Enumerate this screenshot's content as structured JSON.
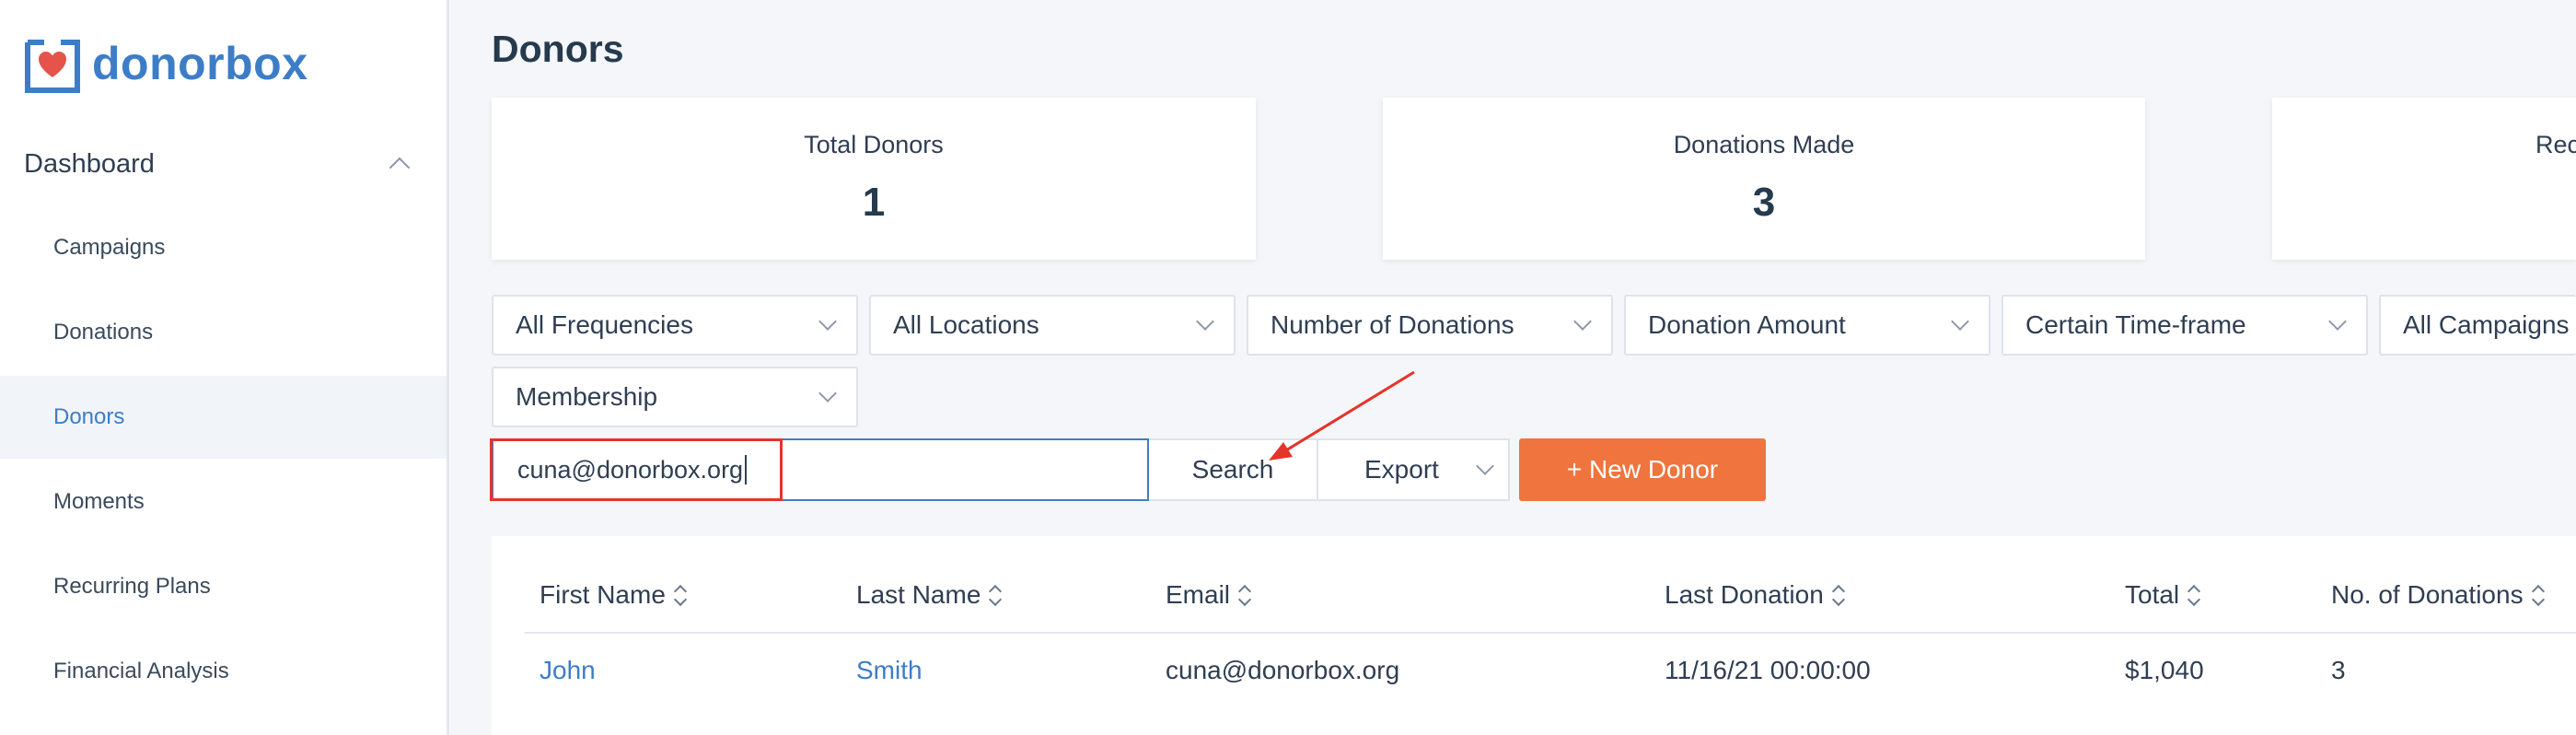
{
  "brand": {
    "name": "donorbox",
    "primary_color": "#3d7dc8",
    "accent_color": "#f0743e",
    "heart_color": "#e5534b"
  },
  "sidebar": {
    "section": "Dashboard",
    "items": [
      {
        "label": "Campaigns",
        "active": false
      },
      {
        "label": "Donations",
        "active": false
      },
      {
        "label": "Donors",
        "active": true
      },
      {
        "label": "Moments",
        "active": false
      },
      {
        "label": "Recurring Plans",
        "active": false
      },
      {
        "label": "Financial Analysis",
        "active": false
      }
    ]
  },
  "page": {
    "title": "Donors"
  },
  "stats": [
    {
      "label": "Total Donors",
      "value": "1"
    },
    {
      "label": "Donations Made",
      "value": "3"
    },
    {
      "label": "Rec",
      "value": ""
    }
  ],
  "filters": [
    "All Frequencies",
    "All Locations",
    "Number of Donations",
    "Donation Amount",
    "Certain Time-frame",
    "All Campaigns",
    "Membership"
  ],
  "search": {
    "value": "cuna@donorbox.org",
    "button_label": "Search"
  },
  "export": {
    "label": "Export"
  },
  "new_donor": {
    "label": "+ New Donor"
  },
  "table": {
    "columns": [
      "First Name",
      "Last Name",
      "Email",
      "Last Donation",
      "Total",
      "No. of Donations"
    ],
    "rows": [
      [
        "John",
        "Smith",
        "cuna@donorbox.org",
        "11/16/21 00:00:00",
        "$1,040",
        "3"
      ]
    ]
  },
  "annotation": {
    "highlight_color": "#e5342a"
  }
}
